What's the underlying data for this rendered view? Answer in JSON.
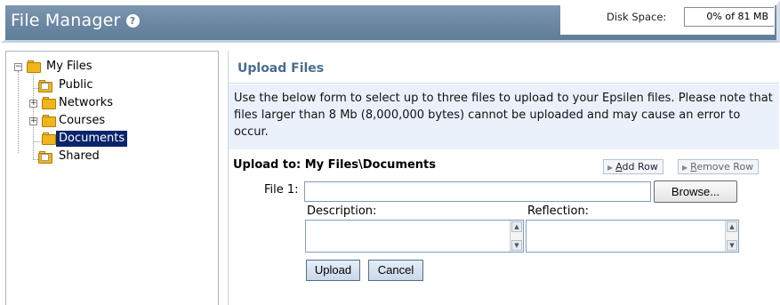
{
  "header": {
    "title": "File Manager",
    "help_icon": "help-circle-icon",
    "disk_label": "Disk Space:",
    "disk_value": "0% of 81 MB"
  },
  "tree": {
    "items": [
      {
        "label": "My Files",
        "icon": "folder-icon",
        "expander": "−",
        "selected": false
      },
      {
        "label": "Public",
        "icon": "folder-icon",
        "selected": false
      },
      {
        "label": "Networks",
        "icon": "folder-icon",
        "expander": "+",
        "selected": false
      },
      {
        "label": "Courses",
        "icon": "folder-icon",
        "expander": "+",
        "selected": false
      },
      {
        "label": "Documents",
        "icon": "folder-icon",
        "selected": true
      },
      {
        "label": "Shared",
        "icon": "folder-icon",
        "selected": false
      }
    ]
  },
  "upload": {
    "title": "Upload Files",
    "instructions": "Use the below form to select up to three files to upload to your Epsilen files. Please note that files larger than 8 Mb (8,000,000 bytes) cannot be uploaded and may cause an error to occur.",
    "upload_to": "Upload to: My Files\\Documents",
    "add_row_first": "A",
    "add_row_rest": "dd Row",
    "remove_row_first": "R",
    "remove_row_rest": "emove Row",
    "file1_label": "File 1:",
    "file1_value": "",
    "browse_label": "Browse...",
    "description_label": "Description:",
    "reflection_label": "Reflection:",
    "upload_label": "Upload",
    "cancel_label": "Cancel"
  },
  "colors": {
    "header_bg": "#6f8aa5",
    "selection": "#0a246a",
    "instructions_bg": "#eaf1fb",
    "panel_title": "#4a6d8f"
  }
}
